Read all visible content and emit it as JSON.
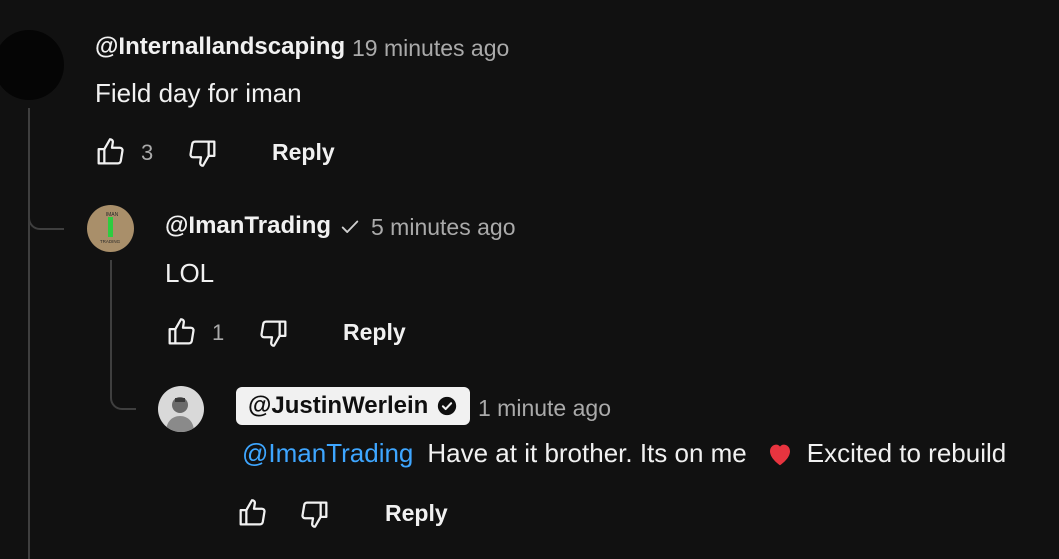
{
  "comment1": {
    "handle": "@Internallandscaping",
    "time": "19 minutes ago",
    "text": "Field day for iman",
    "like_count": "3",
    "reply_label": "Reply",
    "like_icon": "thumbs-up-icon",
    "dislike_icon": "thumbs-down-icon"
  },
  "comment2": {
    "handle": "@ImanTrading",
    "verified_icon": "checkmark-icon",
    "time": "5 minutes ago",
    "text": "LOL",
    "like_count": "1",
    "reply_label": "Reply",
    "avatar_text_top": "IMAN",
    "avatar_text_bottom": "TRADING"
  },
  "comment3": {
    "handle": "@JustinWerlein",
    "verified_icon": "verified-badge-icon",
    "time": "1 minute ago",
    "mention": "@ImanTrading",
    "text_part1": "Have at it brother. Its on me",
    "emoji": "❤️",
    "text_part2": "Excited to rebuild",
    "reply_label": "Reply"
  },
  "colors": {
    "background": "#111111",
    "text": "#f1f1f1",
    "secondary_text": "#aaaaaa",
    "mention": "#3ea6ff",
    "owner_chip_bg": "#f1f1f1",
    "heart": "#e8343f"
  }
}
